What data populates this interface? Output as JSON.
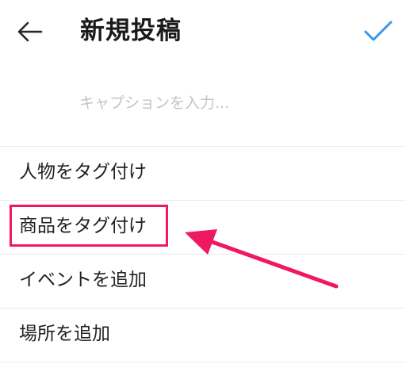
{
  "header": {
    "back_icon": "arrow-left-icon",
    "title": "新規投稿",
    "confirm_icon": "check-icon",
    "accent_color": "#3897f0"
  },
  "caption": {
    "placeholder": "キャプションを入力...",
    "value": ""
  },
  "options": [
    {
      "label": "人物をタグ付け"
    },
    {
      "label": "商品をタグ付け"
    },
    {
      "label": "イベントを追加"
    },
    {
      "label": "場所を追加"
    }
  ],
  "annotation": {
    "highlight_color": "#f0195f",
    "highlighted_option": "商品をタグ付け"
  }
}
